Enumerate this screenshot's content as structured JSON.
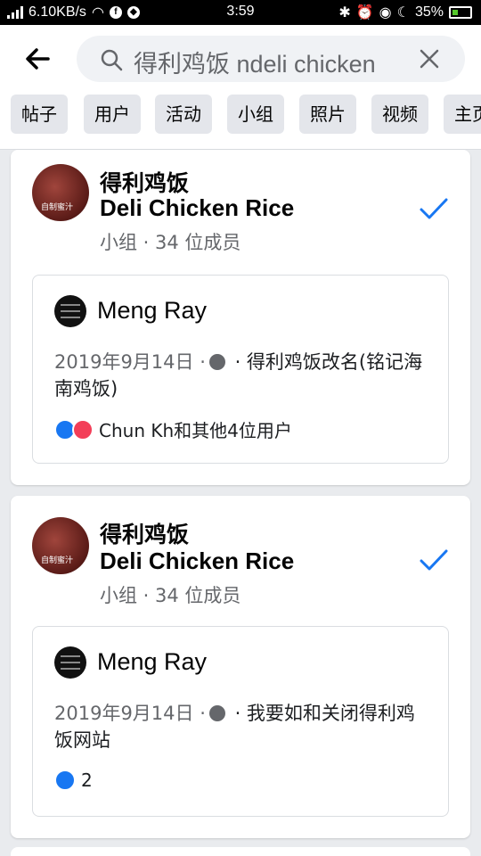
{
  "status": {
    "speed": "6.10KB/s",
    "time": "3:59",
    "battery": "35%"
  },
  "search": {
    "query": "得利鸡饭 ndeli chicken"
  },
  "chips": [
    "帖子",
    "用户",
    "活动",
    "小组",
    "照片",
    "视频",
    "主页"
  ],
  "results": [
    {
      "group_name_zh": "得利鸡饭",
      "group_name_en": "Deli Chicken Rice",
      "group_meta": "小组 · 34 位成员",
      "avatar_label": "自制蜜汁",
      "author": "Meng Ray",
      "date": "2019年9月14日 ·",
      "post_text": " · 得利鸡饭改名(铭记海南鸡饭)",
      "reactions": "Chun Kh和其他4位用户"
    },
    {
      "group_name_zh": "得利鸡饭",
      "group_name_en": "Deli Chicken Rice",
      "group_meta": "小组 · 34 位成员",
      "avatar_label": "自制蜜汁",
      "author": "Meng Ray",
      "date": "2019年9月14日 ·",
      "post_text": " · 我要如和关闭得利鸡饭网站",
      "reactions": "2"
    }
  ],
  "colors": {
    "accent": "#1877f2",
    "love": "#f33e58",
    "bg": "#e9ebee"
  },
  "icons": [
    "back-arrow-icon",
    "search-icon",
    "clear-icon",
    "check-icon",
    "globe-icon",
    "like-icon",
    "love-icon"
  ]
}
